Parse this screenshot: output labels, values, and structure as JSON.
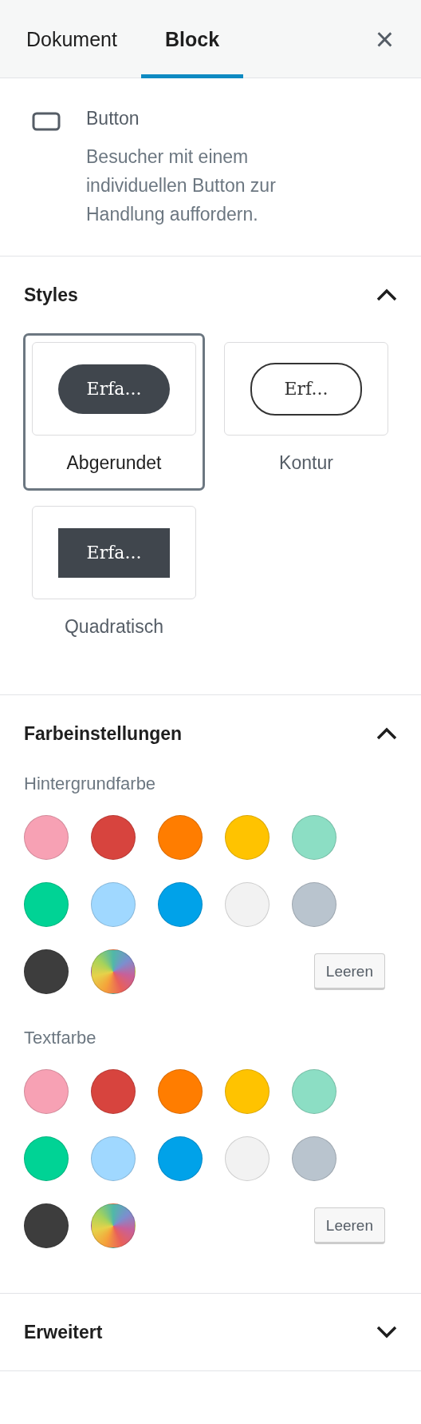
{
  "tabs": [
    {
      "label": "Dokument",
      "selected": false
    },
    {
      "label": "Block",
      "selected": true
    }
  ],
  "close_button": {
    "label": "×"
  },
  "block_info": {
    "title": "Button",
    "description": "Besucher mit einem individuellen Button zur Handlung auffordern."
  },
  "styles_panel": {
    "title": "Styles",
    "expanded": true,
    "options": [
      {
        "kind": "rounded",
        "preview": "Erfa...",
        "label": "Abgerundet",
        "selected": true
      },
      {
        "kind": "outline",
        "preview": "Erf...",
        "label": "Kontur",
        "selected": false
      },
      {
        "kind": "squared",
        "preview": "Erfa...",
        "label": "Quadratisch",
        "selected": false
      }
    ]
  },
  "color_panel": {
    "title": "Farbeinstellungen",
    "expanded": true,
    "groups": [
      {
        "label": "Hintergrundfarbe",
        "clear_button": "Leeren",
        "swatches": [
          {
            "kind": "color",
            "color": "#f7a1b4",
            "selected": false
          },
          {
            "kind": "color",
            "color": "#d7443e",
            "selected": false
          },
          {
            "kind": "color",
            "color": "#ff7d00",
            "selected": false
          },
          {
            "kind": "color",
            "color": "#ffc300",
            "selected": false
          },
          {
            "kind": "color",
            "color": "#8cdec4",
            "selected": false
          },
          {
            "kind": "color",
            "color": "#00d395",
            "selected": false
          },
          {
            "kind": "color",
            "color": "#a0d8ff",
            "selected": false
          },
          {
            "kind": "color",
            "color": "#00a2e9",
            "selected": false
          },
          {
            "kind": "color",
            "color": "#f2f2f2",
            "selected": false
          },
          {
            "kind": "color",
            "color": "#b9c4ce",
            "selected": false
          },
          {
            "kind": "color",
            "color": "#3d3d3d",
            "selected": false
          },
          {
            "kind": "custom",
            "selected": false
          }
        ]
      },
      {
        "label": "Textfarbe",
        "clear_button": "Leeren",
        "swatches": [
          {
            "kind": "color",
            "color": "#f7a1b4",
            "selected": false
          },
          {
            "kind": "color",
            "color": "#d7443e",
            "selected": false
          },
          {
            "kind": "color",
            "color": "#ff7d00",
            "selected": false
          },
          {
            "kind": "color",
            "color": "#ffc300",
            "selected": false
          },
          {
            "kind": "color",
            "color": "#8cdec4",
            "selected": false
          },
          {
            "kind": "color",
            "color": "#00d395",
            "selected": false
          },
          {
            "kind": "color",
            "color": "#a0d8ff",
            "selected": false
          },
          {
            "kind": "color",
            "color": "#00a2e9",
            "selected": false
          },
          {
            "kind": "color",
            "color": "#f2f2f2",
            "selected": false
          },
          {
            "kind": "color",
            "color": "#b9c4ce",
            "selected": false
          },
          {
            "kind": "color",
            "color": "#3d3d3d",
            "selected": false
          },
          {
            "kind": "custom",
            "selected": false
          }
        ]
      }
    ]
  },
  "advanced_panel": {
    "title": "Erweitert",
    "expanded": false
  }
}
